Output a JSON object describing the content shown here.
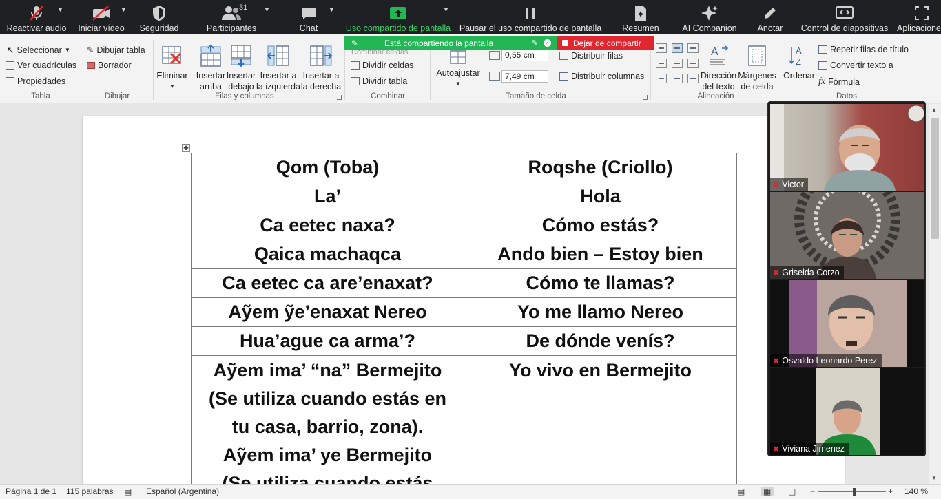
{
  "zoom_toolbar": {
    "unmute": "Reactivar audio",
    "start_video": "Iniciar vídeo",
    "security": "Seguridad",
    "participants": "Participantes",
    "participant_count": "31",
    "chat": "Chat",
    "share": "Uso compartido de pantalla",
    "pause_share": "Pausar el uso compartido de pantalla",
    "summary": "Resumen",
    "ai_companion": "AI Companion",
    "annotate": "Anotar",
    "slide_control": "Control de diapositivas",
    "apps": "Aplicaciones"
  },
  "share_banner": {
    "text": "Está compartiendo la pantalla",
    "stop": "Dejar de compartir",
    "hidden_label": "Combinar celdas"
  },
  "ribbon": {
    "select": "Seleccionar",
    "view_gridlines": "Ver cuadrículas",
    "properties": "Propiedades",
    "group_table": "Tabla",
    "draw_table": "Dibujar tabla",
    "eraser": "Borrador",
    "group_draw": "Dibujar",
    "delete": "Eliminar",
    "insert_above_1": "Insertar",
    "insert_above_2": "arriba",
    "insert_below_1": "Insertar",
    "insert_below_2": "debajo",
    "insert_left_1": "Insertar a",
    "insert_left_2": "la izquierda",
    "insert_right_1": "Insertar a",
    "insert_right_2": "la derecha",
    "group_rows_cols": "Filas y columnas",
    "split_cells": "Dividir celdas",
    "split_table": "Dividir tabla",
    "group_merge": "Combinar",
    "autofit": "Autoajustar",
    "height_value": "0,55 cm",
    "width_value": "7,49 cm",
    "distribute_rows": "Distribuir filas",
    "distribute_cols": "Distribuir columnas",
    "group_cell_size": "Tamaño de celda",
    "text_direction_1": "Dirección",
    "text_direction_2": "del texto",
    "cell_margins_1": "Márgenes",
    "cell_margins_2": "de celda",
    "group_alignment": "Alineación",
    "sort": "Ordenar",
    "repeat_header": "Repetir filas de título",
    "convert_text": "Convertir texto a",
    "formula": "Fórmula",
    "group_data": "Datos"
  },
  "table": {
    "rows": [
      [
        "Qom (Toba)",
        "Roqshe (Criollo)"
      ],
      [
        "La’",
        "Hola"
      ],
      [
        "Ca eetec naxa?",
        "Cómo estás?"
      ],
      [
        "Qaica machaqca",
        "Ando bien – Estoy bien"
      ],
      [
        "Ca eetec ca are’enaxat?",
        "Cómo te llamas?"
      ],
      [
        "Aỹem ỹe’enaxat Nereo",
        "Yo me llamo Nereo"
      ],
      [
        "Hua’ague ca arma’?",
        "De dónde venís?"
      ]
    ],
    "last_row_left": [
      "Aỹem ima’ “na” Bermejito",
      "(Se utiliza cuando estás en",
      "tu casa, barrio, zona).",
      "Aỹem ima’ ye Bermejito",
      "(Se utiliza cuando estás"
    ],
    "last_row_right": "Yo vivo en Bermejito"
  },
  "participants": [
    {
      "name": "Victor"
    },
    {
      "name": "Griselda Corzo"
    },
    {
      "name": "Osvaldo Leonardo Perez"
    },
    {
      "name": "Viviana Jimenez"
    }
  ],
  "status_bar": {
    "page": "Página 1 de 1",
    "words": "115 palabras",
    "language": "Español (Argentina)",
    "zoom": "140 %"
  },
  "colors": {
    "zoom_bar": "#1f2023",
    "share_green": "#23b654",
    "stop_red": "#e0262e"
  }
}
